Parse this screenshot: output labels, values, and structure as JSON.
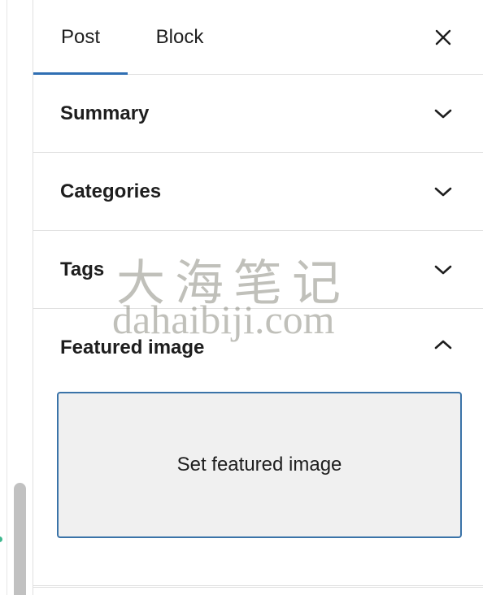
{
  "tabs": {
    "post_label": "Post",
    "block_label": "Block",
    "active": "Post"
  },
  "close_icon": "close-icon",
  "panels": [
    {
      "label": "Summary",
      "expanded": false,
      "icon": "chevron-down-icon"
    },
    {
      "label": "Categories",
      "expanded": false,
      "icon": "chevron-down-icon"
    },
    {
      "label": "Tags",
      "expanded": false,
      "icon": "chevron-down-icon"
    },
    {
      "label": "Featured image",
      "expanded": true,
      "icon": "chevron-up-icon"
    }
  ],
  "featured_image": {
    "button_label": "Set featured image"
  },
  "watermark": {
    "chinese": "大海笔记",
    "site": "dahaibiji.com"
  },
  "colors": {
    "accent": "#2f6fb3",
    "button_border": "#3a73a8",
    "button_bg": "#f0f0f0",
    "text": "#1e1e1e",
    "divider": "#e0e0e0"
  }
}
